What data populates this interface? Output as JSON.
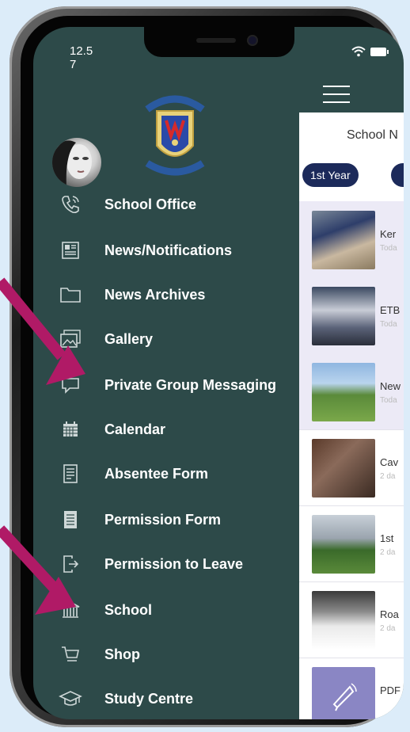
{
  "status": {
    "time": "12.5\n7"
  },
  "content": {
    "title": "School N",
    "chips": [
      "1st Year",
      ""
    ],
    "rows": [
      {
        "title": "Ker",
        "date": "Toda",
        "highlight": true
      },
      {
        "title": "ETB",
        "date": "Toda",
        "highlight": true
      },
      {
        "title": "New",
        "date": "Toda",
        "highlight": true
      },
      {
        "title": "Cav",
        "date": "2 da",
        "highlight": false
      },
      {
        "title": "1st",
        "date": "2 da",
        "highlight": false
      },
      {
        "title": "Roa",
        "date": "2 da",
        "highlight": false
      },
      {
        "title": "PDF",
        "date": "",
        "highlight": false
      }
    ]
  },
  "menu": {
    "items": [
      {
        "label": "School Office",
        "icon": "phone-icon"
      },
      {
        "label": "News/Notifications",
        "icon": "newspaper-icon"
      },
      {
        "label": "News Archives",
        "icon": "folder-icon"
      },
      {
        "label": "Gallery",
        "icon": "gallery-icon"
      },
      {
        "label": "Private Group Messaging",
        "icon": "message-icon"
      },
      {
        "label": "Calendar",
        "icon": "calendar-icon"
      },
      {
        "label": "Absentee Form",
        "icon": "form-icon"
      },
      {
        "label": "Permission Form",
        "icon": "document-icon"
      },
      {
        "label": "Permission to Leave",
        "icon": "exit-icon"
      },
      {
        "label": "School",
        "icon": "school-building-icon"
      },
      {
        "label": "Shop",
        "icon": "cart-icon"
      },
      {
        "label": "Study Centre",
        "icon": "graduation-cap-icon"
      }
    ]
  },
  "colors": {
    "drawer": "#2d4a49",
    "chip": "#1c2a5a",
    "arrow": "#b01a66",
    "background": "#dcecf9"
  }
}
